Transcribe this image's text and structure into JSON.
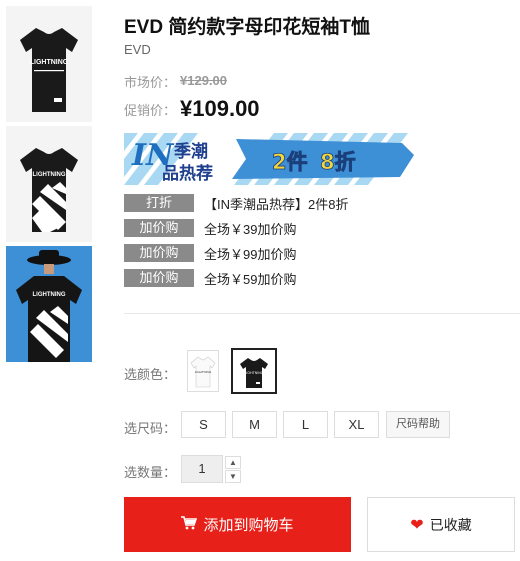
{
  "thumbnails": [
    {
      "alt": "white-print tee front",
      "print_text": "LIGHTNING"
    },
    {
      "alt": "diagonal stripe tee front",
      "print_text": "LIGHTNING"
    },
    {
      "alt": "model wearing tee back",
      "print_text": "LIGHTNING"
    }
  ],
  "product": {
    "title": "EVD 简约款字母印花短袖T恤",
    "brand": "EVD"
  },
  "price": {
    "market_label": "市场价：",
    "market_value": "¥129.00",
    "promo_label": "促销价：",
    "promo_value": "¥109.00"
  },
  "banner": {
    "left_big": "IN",
    "left_top": "季潮",
    "left_bottom": "品热荐",
    "right_text_a": "2件",
    "right_text_b": "8折"
  },
  "promotions": [
    {
      "tag": "打折",
      "text": "【IN季潮品热荐】2件8折"
    },
    {
      "tag": "加价购",
      "text": "全场￥39加价购"
    },
    {
      "tag": "加价购",
      "text": "全场￥99加价购"
    },
    {
      "tag": "加价购",
      "text": "全场￥59加价购"
    }
  ],
  "options": {
    "color_label": "选颜色：",
    "colors": [
      {
        "name": "white",
        "print_text": "LIGHTNING"
      },
      {
        "name": "black",
        "print_text": "LIGHTNING",
        "selected": true
      }
    ],
    "size_label": "选尺码：",
    "sizes": [
      "S",
      "M",
      "L",
      "XL"
    ],
    "size_help": "尺码帮助",
    "qty_label": "选数量：",
    "qty_value": "1"
  },
  "actions": {
    "add_cart": "添加到购物车",
    "favorite": "已收藏"
  },
  "colors": {
    "accent_red": "#e8201a",
    "tag_gray": "#8a8a8a",
    "banner_blue": "#3d8fd6",
    "banner_yellow": "#f5d63a"
  }
}
